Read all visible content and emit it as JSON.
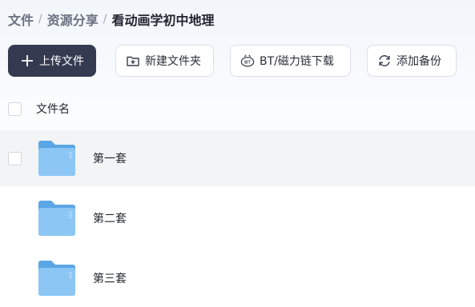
{
  "breadcrumb": {
    "items": [
      "文件",
      "资源分享",
      "看动画学初中地理"
    ],
    "separator": "/"
  },
  "toolbar": {
    "upload_label": "上传文件",
    "new_folder_label": "新建文件夹",
    "bt_label": "BT/磁力链下载",
    "backup_label": "添加备份"
  },
  "table": {
    "header": "文件名",
    "rows": [
      {
        "name": "第一套",
        "type": "folder",
        "icon": "folder-icon"
      },
      {
        "name": "第二套",
        "type": "folder",
        "icon": "folder-icon"
      },
      {
        "name": "第三套",
        "type": "folder",
        "icon": "folder-icon"
      }
    ]
  },
  "colors": {
    "primary": "#343a50",
    "folder": "#6fb3ec",
    "row_hover": "#f3f4f6"
  }
}
